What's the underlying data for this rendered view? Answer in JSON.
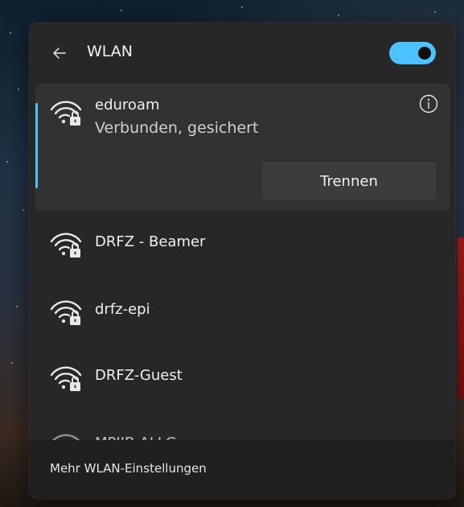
{
  "header": {
    "title": "WLAN",
    "toggle_state": "on"
  },
  "connected": {
    "name": "eduroam",
    "status": "Verbunden, gesichert",
    "disconnect_label": "Trennen"
  },
  "networks": [
    {
      "name": "DRFZ - Beamer",
      "icon": "wifi-lock-icon"
    },
    {
      "name": "drfz-epi",
      "icon": "wifi-lock-icon"
    },
    {
      "name": "DRFZ-Guest",
      "icon": "wifi-lock-icon"
    },
    {
      "name": "MPIIB-ALLG",
      "icon": "wifi-lock-icon"
    }
  ],
  "footer": {
    "link_label": "Mehr WLAN-Einstellungen"
  },
  "colors": {
    "accent": "#4cc2ff",
    "panel": "#272727",
    "connected_bg": "#323232"
  }
}
